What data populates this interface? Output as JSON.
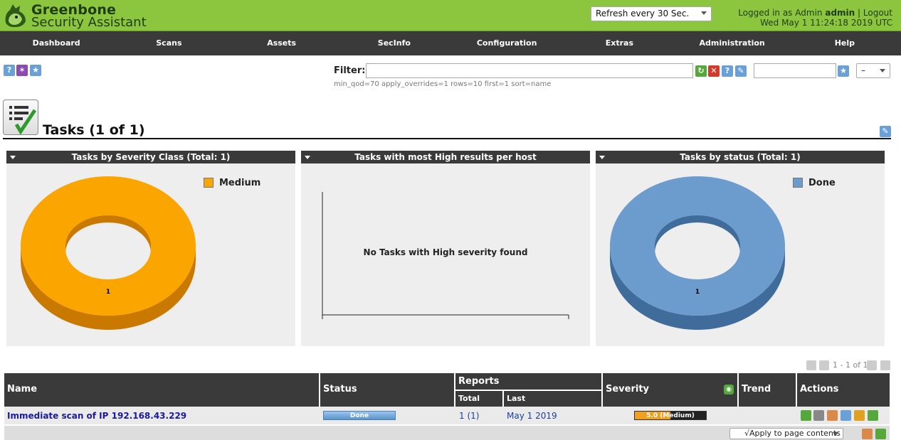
{
  "brand": {
    "line1": "Greenbone",
    "line2": "Security Assistant"
  },
  "header": {
    "refresh_value": "Refresh every 30 Sec.",
    "logged_in_prefix": "Logged in as",
    "role": "Admin",
    "user": "admin",
    "separator": "|",
    "logout": "Logout",
    "datetime": "Wed May 1 11:24:18 2019 UTC"
  },
  "nav": [
    "Dashboard",
    "Scans",
    "Assets",
    "SecInfo",
    "Configuration",
    "Extras",
    "Administration",
    "Help"
  ],
  "filter": {
    "label": "Filter",
    "value": "",
    "hint": "min_qod=70 apply_overrides=1 rows=10 first=1 sort=name",
    "saved_value": "",
    "select_value": "–"
  },
  "page": {
    "title": "Tasks (1 of 1)"
  },
  "panels": [
    {
      "title": "Tasks by Severity Class (Total: 1)",
      "legend": "Medium",
      "slice_label": "1",
      "color": "#fba500",
      "dark": "#c97900"
    },
    {
      "title": "Tasks with most High results per host",
      "message": "No Tasks with High severity found"
    },
    {
      "title": "Tasks by status (Total: 1)",
      "legend": "Done",
      "slice_label": "1",
      "color": "#6c9bcd",
      "dark": "#3f6c9a"
    }
  ],
  "pagination": {
    "text": "1 - 1 of 1"
  },
  "table": {
    "headers": {
      "name": "Name",
      "status": "Status",
      "reports": "Reports",
      "total": "Total",
      "last": "Last",
      "severity": "Severity",
      "trend": "Trend",
      "actions": "Actions"
    },
    "rows": [
      {
        "name": "Immediate scan of IP 192.168.43.229",
        "status": "Done",
        "total": "1 (1)",
        "last": "May 1 2019",
        "severity": "5.0 (Medium)",
        "severity_fraction": 0.5
      }
    ]
  },
  "bulk": {
    "apply": "√Apply to page contents"
  }
}
